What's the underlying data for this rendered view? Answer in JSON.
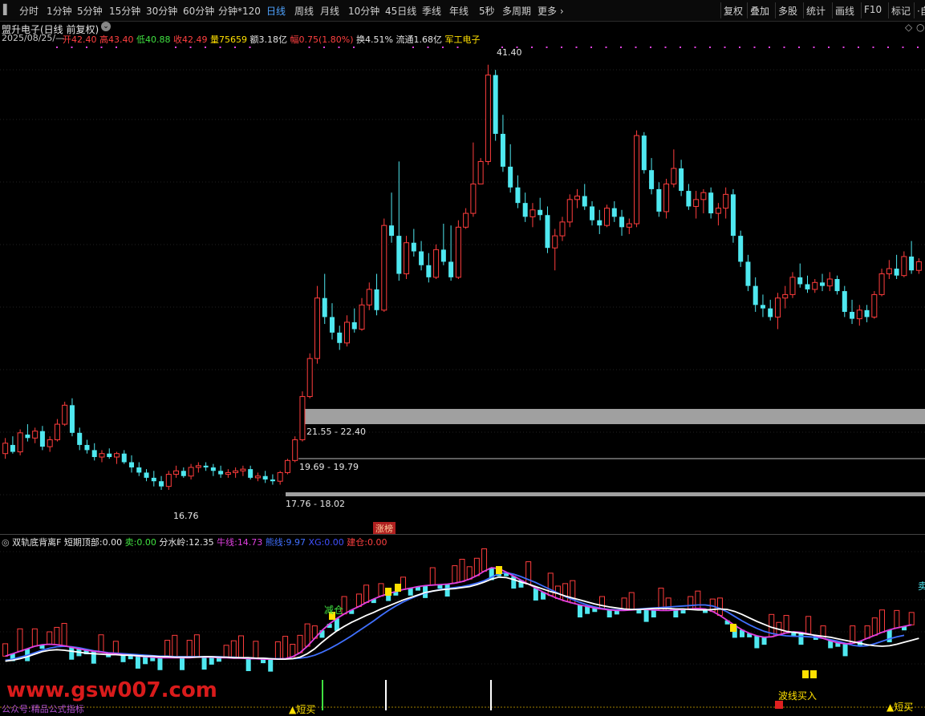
{
  "toolbar": {
    "periods": [
      "分时",
      "1分钟",
      "5分钟",
      "15分钟",
      "30分钟",
      "60分钟",
      "分钟*120",
      "日线",
      "周线",
      "月线",
      "10分钟",
      "45日线",
      "季线",
      "年线",
      "5秒",
      "多周期",
      "更多 ›"
    ],
    "active": "日线",
    "right": [
      "复权",
      "叠加",
      "多股",
      "统计",
      "画线",
      "F10",
      "标记",
      "·自"
    ]
  },
  "info": {
    "title": "盟升电子(日线 前复权)",
    "date": "2025/08/25/—",
    "open_label": "开",
    "open": "42.40",
    "high_label": "高",
    "high": "43.40",
    "low_label": "低",
    "low": "40.88",
    "close_label": "收",
    "close": "42.49",
    "vol_label": "量",
    "vol": "75659",
    "amount_label": "额",
    "amount": "3.18亿",
    "change_label": "幅",
    "change": "0.75(1.80%)",
    "turnover_label": "换",
    "turnover": "4.51%",
    "float_label": "流通",
    "float": "1.68亿",
    "sector": "军工电子"
  },
  "main_labels": {
    "high_mark": "41.40",
    "low_mark": "16.76",
    "zone1": "21.55 - 22.40",
    "zone2": "19.69 - 19.79",
    "zone3": "17.76 - 18.02",
    "limit_up_tag": "涨榜"
  },
  "indicator": {
    "name": "双轨底背离F",
    "short_top_label": "短期顶部:",
    "short_top": "0.00",
    "sell_label": "卖:",
    "sell": "0.00",
    "divide_label": "分水岭:",
    "divide": "12.35",
    "bull_label": "牛线:",
    "bull": "14.73",
    "bear_label": "熊线:",
    "bear": "9.97",
    "xg_label": "XG:",
    "xg": "0.00",
    "build_label": "建仓:",
    "build": "0.00",
    "reduce": "减仓",
    "buy_short": "▲短买",
    "buy_short2": "▲短买",
    "buy_band": "波线买入",
    "watermark": "www.gsw007.com",
    "footnote": "公众号:精品公式指标",
    "right_char": "卖"
  },
  "colors": {
    "up": "#ff3d3d",
    "down": "#4fe8f0",
    "white_line": "#ffffff",
    "magenta_line": "#e040e0",
    "blue_line": "#4070ff",
    "yellow": "#ffe000",
    "zone_gray": "#a0a0a0"
  },
  "chart_data": {
    "type": "candlestick",
    "price_axis": {
      "min": 15.5,
      "max": 42.5
    },
    "candles": [
      [
        18.9,
        19.8,
        18.6,
        19.5
      ],
      [
        19.4,
        19.9,
        18.9,
        19.0
      ],
      [
        19.0,
        20.3,
        18.8,
        20.1
      ],
      [
        20.0,
        20.6,
        19.6,
        19.8
      ],
      [
        19.8,
        20.4,
        19.5,
        20.2
      ],
      [
        20.2,
        20.5,
        19.1,
        19.3
      ],
      [
        19.3,
        19.9,
        19.0,
        19.7
      ],
      [
        19.7,
        20.9,
        19.6,
        20.6
      ],
      [
        20.6,
        21.9,
        20.5,
        21.7
      ],
      [
        21.7,
        22.1,
        19.9,
        20.1
      ],
      [
        20.1,
        20.4,
        19.1,
        19.4
      ],
      [
        19.4,
        19.7,
        18.9,
        19.1
      ],
      [
        19.1,
        19.5,
        18.5,
        18.7
      ],
      [
        18.7,
        19.1,
        18.4,
        18.9
      ],
      [
        18.9,
        19.2,
        18.6,
        18.7
      ],
      [
        18.7,
        19.0,
        18.3,
        18.9
      ],
      [
        18.9,
        19.1,
        18.3,
        18.4
      ],
      [
        18.4,
        18.8,
        17.8,
        18.1
      ],
      [
        18.1,
        18.4,
        17.6,
        17.8
      ],
      [
        17.8,
        18.0,
        17.3,
        17.5
      ],
      [
        17.5,
        17.9,
        17.0,
        17.3
      ],
      [
        17.3,
        17.6,
        16.8,
        17.0
      ],
      [
        17.0,
        17.9,
        16.8,
        17.7
      ],
      [
        17.7,
        18.2,
        17.5,
        17.9
      ],
      [
        17.9,
        18.1,
        17.5,
        17.6
      ],
      [
        17.6,
        18.3,
        17.4,
        18.1
      ],
      [
        18.1,
        18.4,
        17.8,
        18.2
      ],
      [
        18.2,
        18.4,
        17.9,
        18.1
      ],
      [
        18.1,
        18.3,
        17.6,
        17.9
      ],
      [
        17.9,
        18.2,
        17.5,
        17.7
      ],
      [
        17.7,
        18.0,
        17.5,
        17.8
      ],
      [
        17.8,
        18.1,
        17.5,
        17.9
      ],
      [
        17.9,
        18.2,
        17.6,
        18.0
      ],
      [
        18.0,
        18.2,
        17.4,
        17.5
      ],
      [
        17.5,
        17.8,
        17.3,
        17.6
      ],
      [
        17.6,
        17.9,
        17.2,
        17.4
      ],
      [
        17.4,
        17.7,
        17.1,
        17.3
      ],
      [
        17.3,
        17.9,
        17.1,
        17.8
      ],
      [
        17.8,
        18.6,
        17.7,
        18.5
      ],
      [
        18.5,
        19.9,
        18.4,
        19.7
      ],
      [
        19.7,
        22.5,
        19.6,
        22.2
      ],
      [
        22.2,
        24.7,
        22.1,
        24.4
      ],
      [
        24.4,
        28.6,
        24.1,
        27.9
      ],
      [
        27.9,
        29.3,
        26.4,
        26.8
      ],
      [
        26.8,
        27.6,
        25.5,
        25.9
      ],
      [
        25.9,
        26.3,
        24.9,
        25.3
      ],
      [
        25.3,
        26.9,
        25.1,
        26.5
      ],
      [
        26.5,
        27.3,
        25.9,
        26.1
      ],
      [
        26.1,
        27.9,
        26.0,
        27.5
      ],
      [
        27.5,
        28.8,
        27.2,
        28.4
      ],
      [
        28.4,
        29.3,
        26.9,
        27.2
      ],
      [
        27.2,
        32.5,
        27.1,
        32.1
      ],
      [
        32.1,
        34.0,
        31.1,
        31.5
      ],
      [
        31.5,
        35.8,
        28.9,
        29.3
      ],
      [
        29.3,
        31.5,
        29.0,
        31.1
      ],
      [
        31.1,
        31.9,
        30.3,
        30.6
      ],
      [
        30.6,
        31.2,
        29.5,
        29.8
      ],
      [
        29.8,
        30.5,
        28.8,
        29.1
      ],
      [
        29.1,
        31.0,
        29.0,
        30.7
      ],
      [
        30.7,
        32.2,
        29.8,
        30.0
      ],
      [
        30.0,
        32.1,
        28.9,
        29.1
      ],
      [
        29.1,
        32.4,
        29.0,
        32.0
      ],
      [
        32.0,
        33.1,
        31.9,
        32.8
      ],
      [
        32.8,
        36.9,
        32.6,
        34.5
      ],
      [
        34.5,
        36.0,
        35.0,
        35.8
      ],
      [
        35.8,
        41.4,
        35.6,
        40.8
      ],
      [
        40.8,
        41.1,
        37.0,
        37.4
      ],
      [
        37.4,
        38.5,
        35.2,
        35.5
      ],
      [
        35.5,
        36.8,
        34.0,
        34.3
      ],
      [
        34.3,
        35.0,
        33.1,
        33.4
      ],
      [
        33.4,
        34.0,
        32.3,
        32.6
      ],
      [
        32.6,
        33.4,
        32.0,
        33.0
      ],
      [
        33.0,
        33.7,
        32.4,
        32.7
      ],
      [
        32.7,
        33.2,
        30.5,
        30.8
      ],
      [
        30.8,
        31.9,
        29.5,
        31.5
      ],
      [
        31.5,
        32.6,
        31.2,
        32.3
      ],
      [
        32.3,
        33.9,
        32.0,
        33.6
      ],
      [
        33.6,
        34.2,
        33.1,
        33.8
      ],
      [
        33.8,
        34.5,
        33.0,
        33.2
      ],
      [
        33.2,
        33.5,
        32.1,
        32.4
      ],
      [
        32.4,
        33.0,
        31.6,
        32.1
      ],
      [
        32.1,
        33.3,
        32.0,
        33.1
      ],
      [
        33.1,
        33.5,
        32.3,
        32.6
      ],
      [
        32.6,
        33.0,
        31.5,
        32.0
      ],
      [
        32.0,
        32.5,
        31.6,
        32.2
      ],
      [
        32.2,
        37.6,
        32.0,
        37.3
      ],
      [
        37.3,
        37.5,
        35.1,
        35.3
      ],
      [
        35.3,
        36.0,
        33.9,
        34.2
      ],
      [
        34.2,
        34.6,
        32.6,
        32.9
      ],
      [
        32.9,
        34.8,
        32.5,
        34.5
      ],
      [
        34.5,
        36.5,
        34.3,
        35.4
      ],
      [
        35.4,
        35.9,
        33.8,
        34.1
      ],
      [
        34.1,
        34.5,
        33.0,
        33.2
      ],
      [
        33.2,
        34.1,
        32.5,
        33.6
      ],
      [
        33.6,
        34.2,
        32.8,
        34.0
      ],
      [
        34.0,
        34.3,
        32.5,
        32.8
      ],
      [
        32.8,
        33.4,
        32.1,
        33.1
      ],
      [
        33.1,
        34.3,
        32.5,
        33.9
      ],
      [
        33.9,
        34.2,
        31.1,
        31.5
      ],
      [
        31.5,
        31.8,
        29.7,
        30.0
      ],
      [
        30.0,
        30.4,
        28.3,
        28.6
      ],
      [
        28.6,
        29.1,
        27.1,
        27.5
      ],
      [
        27.5,
        28.1,
        26.8,
        27.3
      ],
      [
        27.3,
        27.8,
        26.6,
        26.8
      ],
      [
        26.8,
        28.2,
        26.1,
        27.9
      ],
      [
        27.9,
        28.6,
        27.3,
        28.1
      ],
      [
        28.1,
        29.4,
        27.9,
        29.1
      ],
      [
        29.1,
        29.9,
        28.5,
        28.7
      ],
      [
        28.7,
        29.2,
        28.2,
        28.4
      ],
      [
        28.4,
        29.0,
        28.2,
        28.8
      ],
      [
        28.8,
        29.3,
        28.3,
        28.6
      ],
      [
        28.6,
        29.4,
        28.3,
        29.0
      ],
      [
        29.0,
        29.2,
        28.1,
        28.3
      ],
      [
        28.3,
        28.6,
        26.8,
        27.1
      ],
      [
        27.1,
        27.8,
        26.4,
        26.7
      ],
      [
        26.7,
        27.5,
        26.3,
        27.2
      ],
      [
        27.2,
        27.5,
        26.5,
        26.8
      ],
      [
        26.8,
        28.3,
        26.7,
        28.1
      ],
      [
        28.1,
        29.6,
        28.0,
        29.3
      ],
      [
        29.3,
        30.1,
        29.0,
        29.6
      ],
      [
        29.6,
        30.4,
        29.0,
        29.2
      ],
      [
        29.2,
        30.6,
        29.1,
        30.3
      ],
      [
        30.3,
        31.2,
        29.3,
        29.5
      ],
      [
        29.5,
        30.2,
        29.3,
        30.0
      ]
    ],
    "indicator_lines": {
      "bull": [
        7,
        7.2,
        7.5,
        7.9,
        8.4,
        8.9,
        9.2,
        9.3,
        9.2,
        9.0,
        8.8,
        8.6,
        8.5,
        8.4,
        8.3,
        8.3,
        8.2,
        8.2,
        8.1,
        8.0,
        8.0,
        7.9,
        7.9,
        7.8,
        7.8,
        7.8,
        7.8,
        7.9,
        7.9,
        7.8,
        7.8,
        7.7,
        7.7,
        7.7,
        7.6,
        7.6,
        7.5,
        7.4,
        7.4,
        7.5,
        7.8,
        8.5,
        9.5,
        10.8,
        12.0,
        13.1,
        14.0,
        14.8,
        15.5,
        16.2,
        16.8,
        17.5,
        18.1,
        18.7,
        19.3,
        19.8,
        20.3,
        20.8,
        21.1,
        21.3,
        21.5,
        21.6,
        21.8,
        22.0,
        22.4,
        22.9,
        23.5,
        23.9,
        23.8,
        23.4,
        22.9,
        22.5,
        22.0,
        21.5,
        21.0,
        20.6,
        20.1,
        19.7,
        19.3,
        18.9,
        18.5,
        18.2,
        17.9,
        17.7,
        17.5,
        17.4,
        17.4,
        17.5,
        17.6,
        17.6,
        17.6,
        17.5,
        17.5,
        17.4,
        17.3,
        17.3,
        17.4,
        17.5,
        17.4,
        17.0,
        16.4,
        15.7,
        15.0,
        14.4,
        13.8,
        13.4,
        13.0,
        12.8,
        12.6,
        12.4,
        12.2,
        12.0,
        11.8,
        11.5,
        11.2,
        10.9,
        10.6,
        10.3,
        10.1,
        10.0,
        10.1,
        10.4,
        10.8,
        11.2,
        11.6
      ],
      "magenta": [
        8,
        8.5,
        9.0,
        9.5,
        10.0,
        10.3,
        10.4,
        10.3,
        10.1,
        9.8,
        9.5,
        9.2,
        9.0,
        8.8,
        8.6,
        8.5,
        8.3,
        8.2,
        8.0,
        7.9,
        7.8,
        7.7,
        7.7,
        7.7,
        7.7,
        7.7,
        7.8,
        7.8,
        7.8,
        7.7,
        7.7,
        7.6,
        7.6,
        7.5,
        7.5,
        7.4,
        7.4,
        7.4,
        7.5,
        7.9,
        8.7,
        10.0,
        11.6,
        13.2,
        14.5,
        15.6,
        16.5,
        17.3,
        18.0,
        18.8,
        19.5,
        20.1,
        20.6,
        21.0,
        21.4,
        21.7,
        22.0,
        22.2,
        22.3,
        22.4,
        22.5,
        22.7,
        23.0,
        23.5,
        24.2,
        25.1,
        25.8,
        25.6,
        24.9,
        24.1,
        23.3,
        22.5,
        21.7,
        20.9,
        20.2,
        19.6,
        19.1,
        18.7,
        18.3,
        18.0,
        17.7,
        17.5,
        17.3,
        17.2,
        17.2,
        17.3,
        17.4,
        17.4,
        17.3,
        17.2,
        17.2,
        17.3,
        17.4,
        17.5,
        17.6,
        17.5,
        17.0,
        16.2,
        15.2,
        14.2,
        13.3,
        12.6,
        12.1,
        11.8,
        11.9,
        12.3,
        12.7,
        12.9,
        12.8,
        12.5,
        12.1,
        11.6,
        11.1,
        10.7,
        10.5,
        10.6,
        11.0,
        11.6,
        12.2,
        12.8,
        13.3,
        13.7,
        14.0,
        14.3
      ],
      "blue": [
        7.2,
        7.4,
        7.8,
        8.2,
        8.7,
        9.2,
        9.6,
        9.9,
        10.0,
        9.9,
        9.7,
        9.4,
        9.1,
        8.9,
        8.7,
        8.6,
        8.5,
        8.4,
        8.3,
        8.2,
        8.1,
        8.0,
        8.0,
        7.9,
        7.9,
        7.9,
        7.9,
        7.9,
        7.9,
        7.9,
        7.8,
        7.8,
        7.7,
        7.7,
        7.6,
        7.6,
        7.5,
        7.5,
        7.5,
        7.5,
        7.6,
        7.8,
        8.2,
        8.8,
        9.5,
        10.3,
        11.2,
        12.1,
        13.1,
        14.1,
        15.1,
        16.2,
        17.2,
        18.1,
        18.9,
        19.6,
        20.2,
        20.7,
        21.1,
        21.4,
        21.6,
        21.8,
        22.0,
        22.3,
        22.7,
        23.2,
        23.9,
        24.6,
        24.8,
        24.5,
        24.0,
        23.4,
        22.8,
        22.1,
        21.4,
        20.7,
        20.0,
        19.4,
        18.8,
        18.3,
        17.9,
        17.6,
        17.4,
        17.3,
        17.3,
        17.4,
        17.5,
        17.6,
        17.7,
        17.8,
        17.9,
        18.0,
        18.1,
        18.2,
        18.3,
        18.3,
        18.1,
        17.6,
        16.9,
        16.0,
        15.1,
        14.3,
        13.6,
        13.0,
        12.6,
        12.3,
        12.1,
        12.0,
        12.0,
        11.9,
        11.8,
        11.6,
        11.3,
        11.0,
        10.6,
        10.2,
        10.0,
        10.1,
        10.5,
        11.0,
        11.5,
        11.9,
        12.2
      ]
    }
  }
}
